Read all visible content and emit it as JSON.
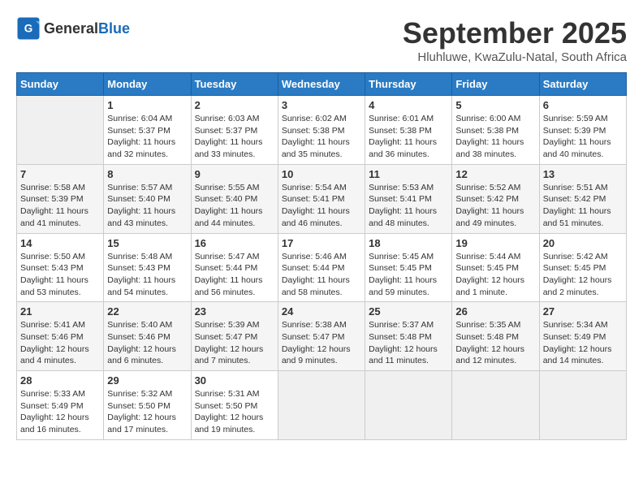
{
  "header": {
    "logo_general": "General",
    "logo_blue": "Blue",
    "month_title": "September 2025",
    "location": "Hluhluwe, KwaZulu-Natal, South Africa"
  },
  "weekdays": [
    "Sunday",
    "Monday",
    "Tuesday",
    "Wednesday",
    "Thursday",
    "Friday",
    "Saturday"
  ],
  "weeks": [
    [
      {
        "day": "",
        "info": ""
      },
      {
        "day": "1",
        "info": "Sunrise: 6:04 AM\nSunset: 5:37 PM\nDaylight: 11 hours\nand 32 minutes."
      },
      {
        "day": "2",
        "info": "Sunrise: 6:03 AM\nSunset: 5:37 PM\nDaylight: 11 hours\nand 33 minutes."
      },
      {
        "day": "3",
        "info": "Sunrise: 6:02 AM\nSunset: 5:38 PM\nDaylight: 11 hours\nand 35 minutes."
      },
      {
        "day": "4",
        "info": "Sunrise: 6:01 AM\nSunset: 5:38 PM\nDaylight: 11 hours\nand 36 minutes."
      },
      {
        "day": "5",
        "info": "Sunrise: 6:00 AM\nSunset: 5:38 PM\nDaylight: 11 hours\nand 38 minutes."
      },
      {
        "day": "6",
        "info": "Sunrise: 5:59 AM\nSunset: 5:39 PM\nDaylight: 11 hours\nand 40 minutes."
      }
    ],
    [
      {
        "day": "7",
        "info": "Sunrise: 5:58 AM\nSunset: 5:39 PM\nDaylight: 11 hours\nand 41 minutes."
      },
      {
        "day": "8",
        "info": "Sunrise: 5:57 AM\nSunset: 5:40 PM\nDaylight: 11 hours\nand 43 minutes."
      },
      {
        "day": "9",
        "info": "Sunrise: 5:55 AM\nSunset: 5:40 PM\nDaylight: 11 hours\nand 44 minutes."
      },
      {
        "day": "10",
        "info": "Sunrise: 5:54 AM\nSunset: 5:41 PM\nDaylight: 11 hours\nand 46 minutes."
      },
      {
        "day": "11",
        "info": "Sunrise: 5:53 AM\nSunset: 5:41 PM\nDaylight: 11 hours\nand 48 minutes."
      },
      {
        "day": "12",
        "info": "Sunrise: 5:52 AM\nSunset: 5:42 PM\nDaylight: 11 hours\nand 49 minutes."
      },
      {
        "day": "13",
        "info": "Sunrise: 5:51 AM\nSunset: 5:42 PM\nDaylight: 11 hours\nand 51 minutes."
      }
    ],
    [
      {
        "day": "14",
        "info": "Sunrise: 5:50 AM\nSunset: 5:43 PM\nDaylight: 11 hours\nand 53 minutes."
      },
      {
        "day": "15",
        "info": "Sunrise: 5:48 AM\nSunset: 5:43 PM\nDaylight: 11 hours\nand 54 minutes."
      },
      {
        "day": "16",
        "info": "Sunrise: 5:47 AM\nSunset: 5:44 PM\nDaylight: 11 hours\nand 56 minutes."
      },
      {
        "day": "17",
        "info": "Sunrise: 5:46 AM\nSunset: 5:44 PM\nDaylight: 11 hours\nand 58 minutes."
      },
      {
        "day": "18",
        "info": "Sunrise: 5:45 AM\nSunset: 5:45 PM\nDaylight: 11 hours\nand 59 minutes."
      },
      {
        "day": "19",
        "info": "Sunrise: 5:44 AM\nSunset: 5:45 PM\nDaylight: 12 hours\nand 1 minute."
      },
      {
        "day": "20",
        "info": "Sunrise: 5:42 AM\nSunset: 5:45 PM\nDaylight: 12 hours\nand 2 minutes."
      }
    ],
    [
      {
        "day": "21",
        "info": "Sunrise: 5:41 AM\nSunset: 5:46 PM\nDaylight: 12 hours\nand 4 minutes."
      },
      {
        "day": "22",
        "info": "Sunrise: 5:40 AM\nSunset: 5:46 PM\nDaylight: 12 hours\nand 6 minutes."
      },
      {
        "day": "23",
        "info": "Sunrise: 5:39 AM\nSunset: 5:47 PM\nDaylight: 12 hours\nand 7 minutes."
      },
      {
        "day": "24",
        "info": "Sunrise: 5:38 AM\nSunset: 5:47 PM\nDaylight: 12 hours\nand 9 minutes."
      },
      {
        "day": "25",
        "info": "Sunrise: 5:37 AM\nSunset: 5:48 PM\nDaylight: 12 hours\nand 11 minutes."
      },
      {
        "day": "26",
        "info": "Sunrise: 5:35 AM\nSunset: 5:48 PM\nDaylight: 12 hours\nand 12 minutes."
      },
      {
        "day": "27",
        "info": "Sunrise: 5:34 AM\nSunset: 5:49 PM\nDaylight: 12 hours\nand 14 minutes."
      }
    ],
    [
      {
        "day": "28",
        "info": "Sunrise: 5:33 AM\nSunset: 5:49 PM\nDaylight: 12 hours\nand 16 minutes."
      },
      {
        "day": "29",
        "info": "Sunrise: 5:32 AM\nSunset: 5:50 PM\nDaylight: 12 hours\nand 17 minutes."
      },
      {
        "day": "30",
        "info": "Sunrise: 5:31 AM\nSunset: 5:50 PM\nDaylight: 12 hours\nand 19 minutes."
      },
      {
        "day": "",
        "info": ""
      },
      {
        "day": "",
        "info": ""
      },
      {
        "day": "",
        "info": ""
      },
      {
        "day": "",
        "info": ""
      }
    ]
  ]
}
